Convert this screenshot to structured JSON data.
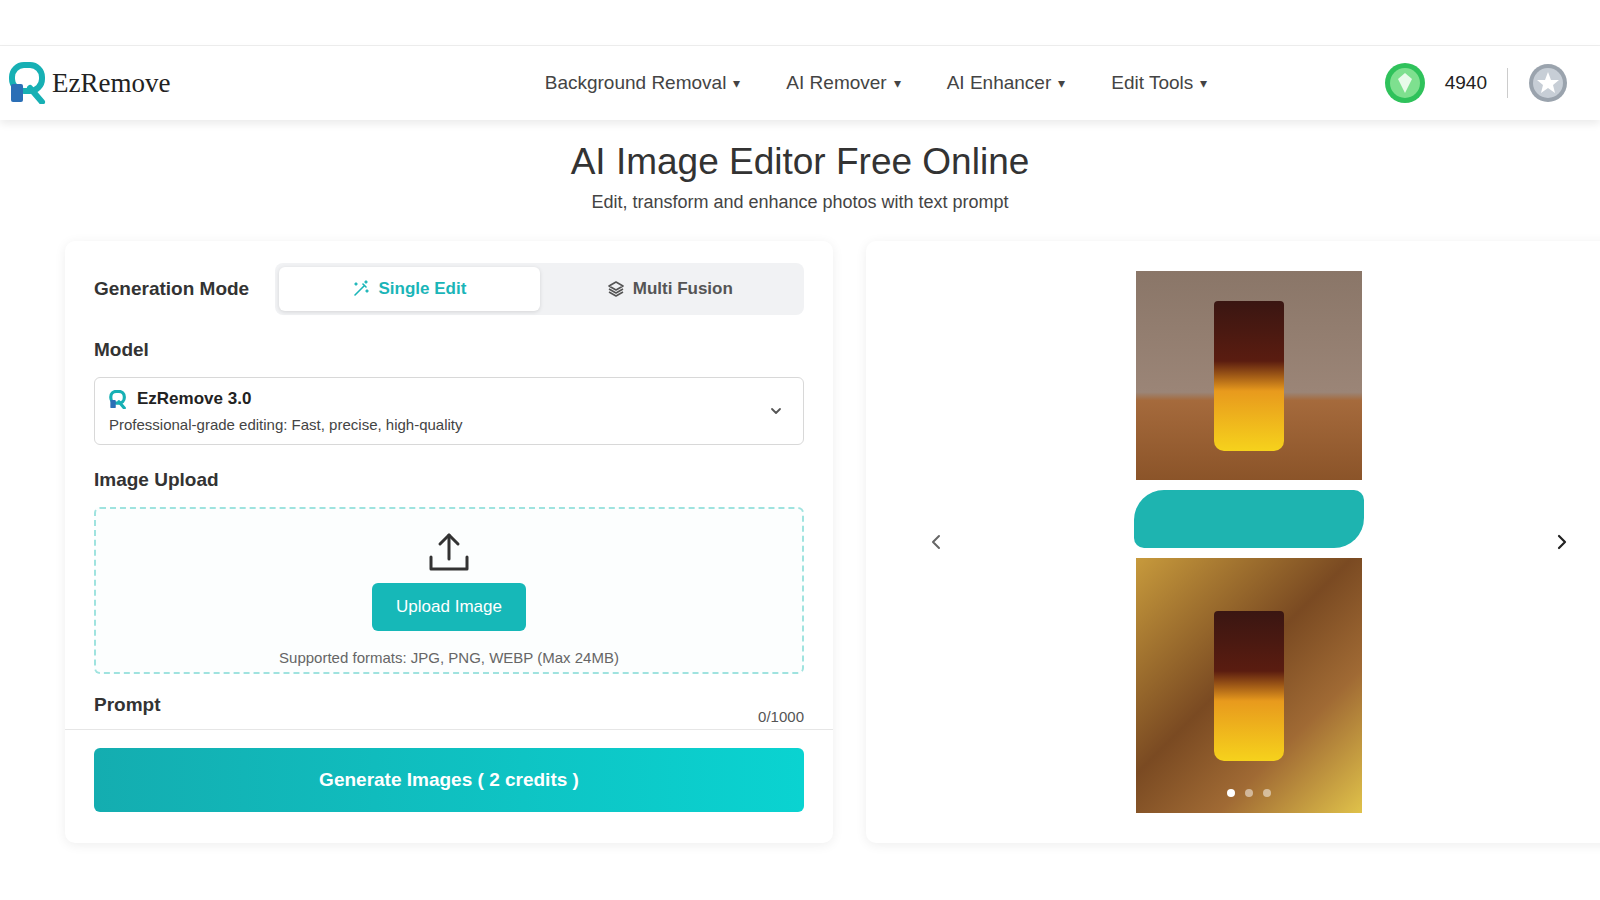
{
  "brand": {
    "name": "EzRemove"
  },
  "nav": [
    {
      "label": "Background Removal",
      "caret": "▾"
    },
    {
      "label": "AI Remover",
      "caret": "▾"
    },
    {
      "label": "AI Enhancer",
      "caret": "▾"
    },
    {
      "label": "Edit Tools",
      "caret": "▾"
    }
  ],
  "credits": "4940",
  "hero": {
    "title": "AI Image Editor Free Online",
    "subtitle": "Edit, transform and enhance photos with text prompt"
  },
  "form": {
    "mode_label": "Generation Mode",
    "modes": [
      {
        "label": "Single Edit",
        "kind": "wand",
        "selected": true
      },
      {
        "label": "Multi Fusion",
        "kind": "layers",
        "selected": false
      }
    ],
    "model_label": "Model",
    "model": {
      "name": "EzRemove 3.0",
      "description": "Professional-grade editing: Fast, precise, high-quality"
    },
    "upload_label": "Image Upload",
    "upload_button": "Upload Image",
    "upload_hint": "Supported formats: JPG, PNG, WEBP (Max 24MB)",
    "prompt_label": "Prompt",
    "prompt_count": "0/1000",
    "generate_button": "Generate Images ( 2 credits )"
  },
  "carousel": {
    "dots": [
      {
        "selected": true
      },
      {
        "selected": false
      },
      {
        "selected": false
      }
    ]
  }
}
